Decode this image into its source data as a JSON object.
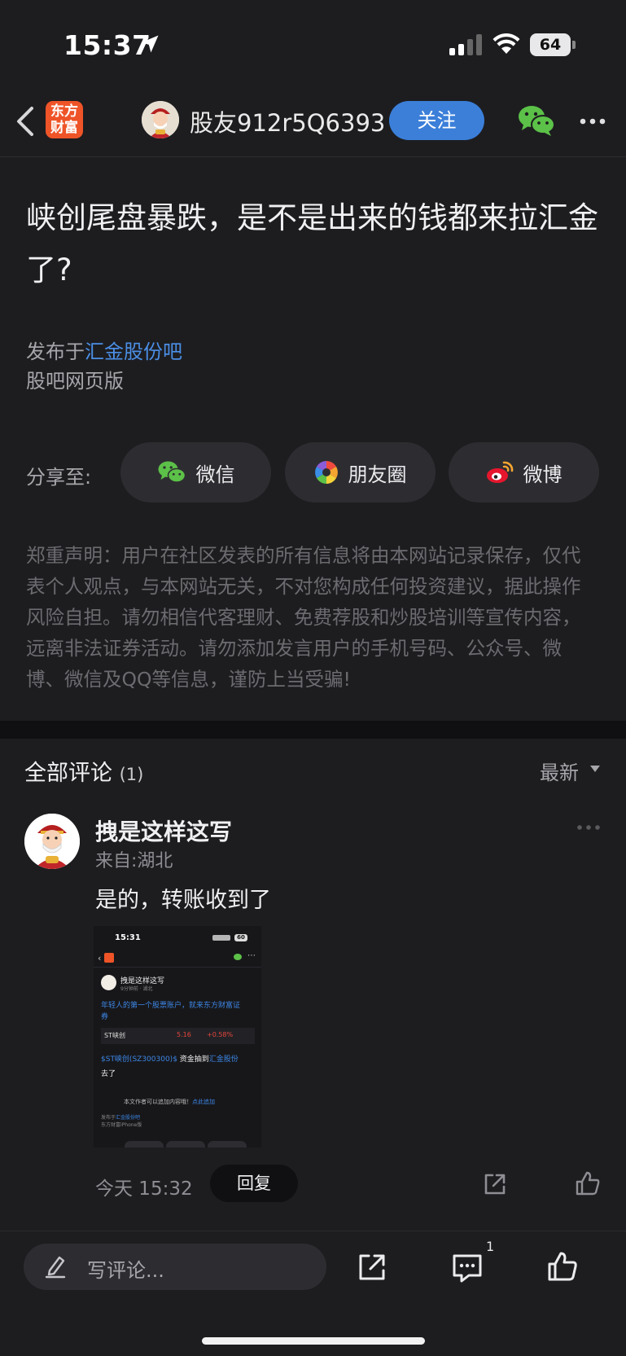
{
  "status_bar": {
    "time": "15:37",
    "battery": "64"
  },
  "nav": {
    "logo_text": "东方财富",
    "username": "股友912r5Q6393",
    "follow_label": "关注"
  },
  "article": {
    "title": "峡创尾盘暴跌，是不是出来的钱都来拉汇金了?",
    "publish_prefix": "发布于",
    "publish_forum": "汇金股份吧",
    "source": "股吧网页版"
  },
  "share": {
    "label": "分享至:",
    "buttons": [
      {
        "label": "微信",
        "icon": "wechat-icon"
      },
      {
        "label": "朋友圈",
        "icon": "moments-icon"
      },
      {
        "label": "微博",
        "icon": "weibo-icon"
      }
    ]
  },
  "disclaimer": "郑重声明：用户在社区发表的所有信息将由本网站记录保存，仅代表个人观点，与本网站无关，不对您构成任何投资建议，据此操作风险自担。请勿相信代客理财、免费荐股和炒股培训等宣传内容，远离非法证券活动。请勿添加发言用户的手机号码、公众号、微博、微信及QQ等信息，谨防上当受骗!",
  "comments": {
    "title": "全部评论",
    "count": "(1)",
    "sort_label": "最新",
    "items": [
      {
        "author": "拽是这样这写",
        "location": "来自:湖北",
        "text": "是的，转账收到了",
        "time": "今天 15:32",
        "reply_label": "回复",
        "image": {
          "time": "15:31",
          "battery": "60",
          "author": "拽是这样这写",
          "meta": "9分钟前 · 湖北",
          "ad_text_1": "年轻人的第一个股票账户，就来东方财富证",
          "ad_text_2": "券",
          "stock_name": "ST峡创",
          "stock_price": "5.16",
          "stock_change": "+0.58%",
          "body_link": "$ST峡创(SZ300300)$",
          "body_middle": " 资金抽到",
          "body_link_2": "汇金股份",
          "body_end": "去了",
          "add_notice": "本文作者可以追加内容哦！",
          "add_link": "点此追加",
          "published_prefix": "发布于",
          "published_forum": "汇金股份吧",
          "published_source": "东方财富iPhone版"
        }
      }
    ]
  },
  "bottom_bar": {
    "placeholder": "写评论...",
    "comment_badge": "1"
  },
  "colors": {
    "background": "#1d1d20",
    "accent_blue": "#3b7fd9",
    "link_blue": "#4b8fe6",
    "logo_orange": "#ee5428"
  }
}
